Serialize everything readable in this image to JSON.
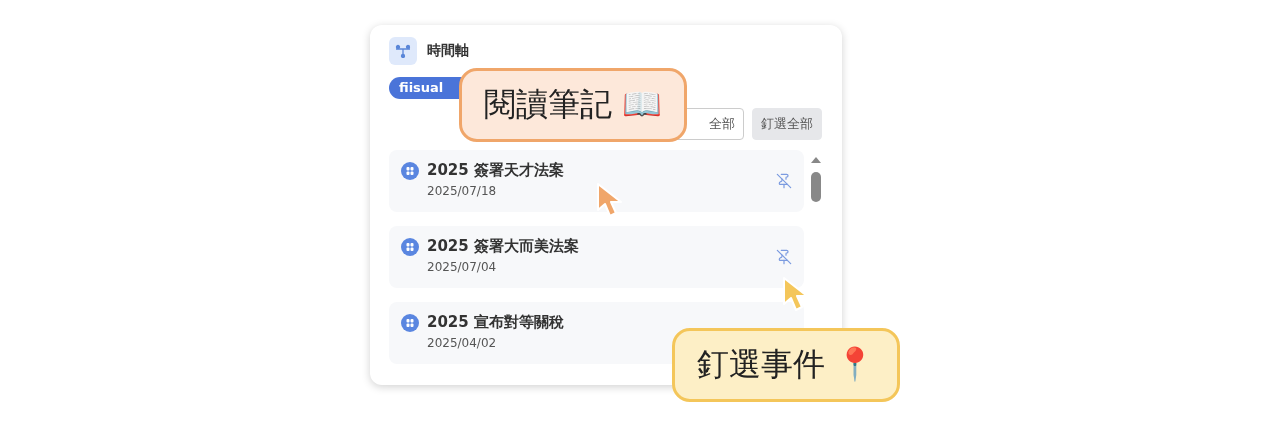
{
  "panel": {
    "title": "時間軸",
    "tag": "fiisual",
    "buttons": [
      {
        "label": "全部",
        "kind": "outline"
      },
      {
        "label": "釘選全部",
        "kind": "filled"
      }
    ]
  },
  "events": [
    {
      "title": "2025 簽署天才法案",
      "date": "2025/07/18",
      "pin_visible": true
    },
    {
      "title": "2025 簽署大而美法案",
      "date": "2025/07/04",
      "pin_visible": true
    },
    {
      "title": "2025 宣布對等關稅",
      "date": "2025/04/02",
      "pin_visible": false
    }
  ],
  "callouts": [
    {
      "text": "閱讀筆記 📖",
      "color": "#f0a66a"
    },
    {
      "text": "釘選事件 📍",
      "color": "#f4c65a"
    }
  ]
}
